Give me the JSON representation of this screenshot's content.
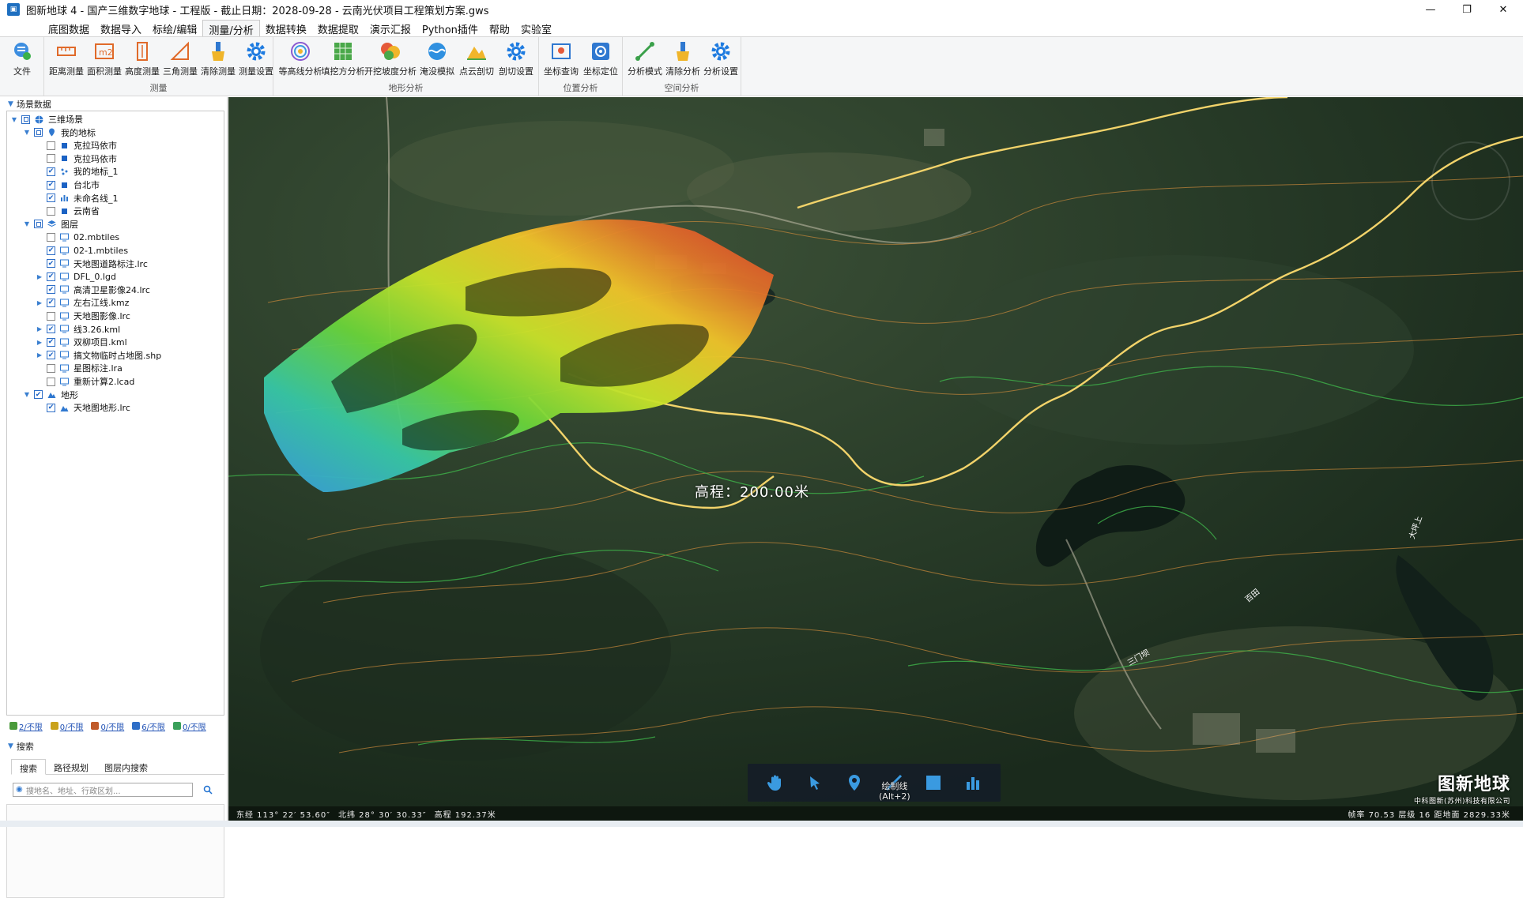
{
  "window": {
    "title": "图新地球 4 - 国产三维数字地球 - 工程版 - 截止日期：2028-09-28 - 云南光伏项目工程策划方案.gws",
    "minimize": "—",
    "restore": "❐",
    "close": "✕"
  },
  "menu": {
    "items": [
      {
        "label": "底图数据"
      },
      {
        "label": "数据导入"
      },
      {
        "label": "标绘/编辑"
      },
      {
        "label": "测量/分析"
      },
      {
        "label": "数据转换"
      },
      {
        "label": "数据提取"
      },
      {
        "label": "演示汇报"
      },
      {
        "label": "Python插件"
      },
      {
        "label": "帮助"
      },
      {
        "label": "实验室"
      }
    ],
    "active_index": 3
  },
  "ribbon": {
    "file": "文件",
    "groups": [
      {
        "label": "测量",
        "buttons": [
          "距离测量",
          "面积测量",
          "高度测量",
          "三角测量",
          "清除测量",
          "测量设置"
        ]
      },
      {
        "label": "地形分析",
        "buttons": [
          "等高线分析",
          "填挖方分析",
          "开挖坡度分析",
          "淹没模拟",
          "点云剖切",
          "剖切设置"
        ]
      },
      {
        "label": "位置分析",
        "buttons": [
          "坐标查询",
          "坐标定位"
        ]
      },
      {
        "label": "空间分析",
        "buttons": [
          "分析模式",
          "清除分析",
          "分析设置"
        ]
      }
    ]
  },
  "left_panel": {
    "header": "场景数据",
    "tree": [
      {
        "label": "三维场景",
        "level": 0,
        "expanded": true,
        "checked": "partial",
        "icon": "globe-icon"
      },
      {
        "label": "我的地标",
        "level": 1,
        "expanded": true,
        "checked": "partial",
        "icon": "pin-icon"
      },
      {
        "label": "克拉玛依市",
        "level": 2,
        "checked": false,
        "icon": "square-icon"
      },
      {
        "label": "克拉玛依市",
        "level": 2,
        "checked": false,
        "icon": "square-icon"
      },
      {
        "label": "我的地标_1",
        "level": 2,
        "checked": true,
        "icon": "dots-icon"
      },
      {
        "label": "台北市",
        "level": 2,
        "checked": true,
        "icon": "square-icon"
      },
      {
        "label": "未命名线_1",
        "level": 2,
        "checked": true,
        "icon": "bars-icon"
      },
      {
        "label": "云南省",
        "level": 2,
        "checked": false,
        "icon": "square-icon"
      },
      {
        "label": "图层",
        "level": 1,
        "expanded": true,
        "checked": "partial",
        "icon": "layers-icon"
      },
      {
        "label": "02.mbtiles",
        "level": 2,
        "checked": false,
        "icon": "monitor-icon"
      },
      {
        "label": "02-1.mbtiles",
        "level": 2,
        "checked": true,
        "icon": "monitor-icon"
      },
      {
        "label": "天地图道路标注.lrc",
        "level": 2,
        "checked": true,
        "icon": "monitor-icon"
      },
      {
        "label": "DFL_0.lgd",
        "level": 2,
        "checked": true,
        "icon": "monitor-icon",
        "has_children": true
      },
      {
        "label": "高清卫星影像24.lrc",
        "level": 2,
        "checked": true,
        "icon": "monitor-icon"
      },
      {
        "label": "左右江线.kmz",
        "level": 2,
        "checked": true,
        "icon": "monitor-icon",
        "has_children": true
      },
      {
        "label": "天地图影像.lrc",
        "level": 2,
        "checked": false,
        "icon": "monitor-icon"
      },
      {
        "label": "线3.26.kml",
        "level": 2,
        "checked": true,
        "icon": "monitor-icon",
        "has_children": true
      },
      {
        "label": "双柳项目.kml",
        "level": 2,
        "checked": true,
        "icon": "monitor-icon",
        "has_children": true
      },
      {
        "label": "搞文物临时占地图.shp",
        "level": 2,
        "checked": true,
        "icon": "monitor-icon",
        "has_children": true
      },
      {
        "label": "星图标注.lra",
        "level": 2,
        "checked": false,
        "icon": "monitor-icon"
      },
      {
        "label": "重新计算2.lcad",
        "level": 2,
        "checked": false,
        "icon": "monitor-icon"
      },
      {
        "label": "地形",
        "level": 1,
        "expanded": true,
        "checked": true,
        "icon": "terrain-icon"
      },
      {
        "label": "天地图地形.lrc",
        "level": 2,
        "checked": true,
        "icon": "terrain-icon"
      }
    ],
    "stats": [
      {
        "text": "2/不限",
        "color": "#4a9a3a"
      },
      {
        "text": "0/不限",
        "color": "#c9a21b"
      },
      {
        "text": "0/不限",
        "color": "#c05a2a"
      },
      {
        "text": "6/不限",
        "color": "#2f6fc7"
      },
      {
        "text": "0/不限",
        "color": "#3aa05a"
      }
    ],
    "search": {
      "header": "搜索",
      "tabs": [
        "搜索",
        "路径规划",
        "图层内搜索"
      ],
      "placeholder": "搜地名、地址、行政区划...",
      "go_icon": "search-icon"
    }
  },
  "map": {
    "elevation_label": "高程：200.00米",
    "toolbar": {
      "tools": [
        "pan-hand-icon",
        "select-arrow-icon",
        "placemark-pin-icon",
        "draw-line-icon",
        "draw-polygon-icon",
        "chart-icon"
      ],
      "tip_title": "绘制线",
      "tip_shortcut": "(Alt+2)"
    },
    "coords": {
      "lon": "东经 113° 22′ 53.60″",
      "lat": "北纬 28° 30′ 30.33″",
      "alt": "高程 192.37米",
      "right": "帧率 70.53  层级 16  距地面 2829.33米"
    },
    "brand": {
      "name": "图新地球",
      "sub": "中科图新(苏州)科技有限公司"
    },
    "place_labels": [
      "大坪上",
      "三门坝",
      "百田"
    ]
  }
}
